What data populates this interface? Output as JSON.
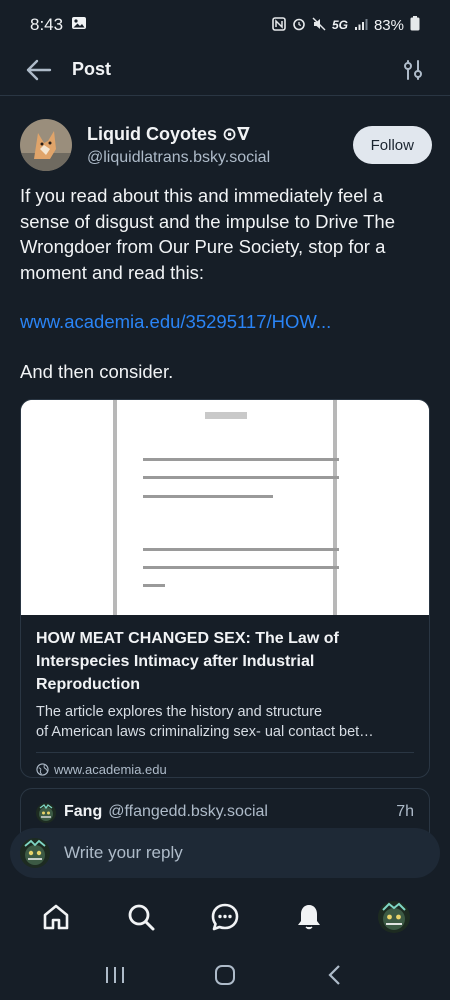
{
  "status_bar": {
    "time": "8:43",
    "network": "5G",
    "battery": "83%"
  },
  "header": {
    "title": "Post"
  },
  "post": {
    "author_display": "Liquid Coyotes ⊙∇",
    "author_handle": "@liquidlatrans.bsky.social",
    "follow_label": "Follow",
    "text_lines": [
      "If you read about this and immediately feel a",
      "sense of disgust and the impulse to Drive The",
      "Wrongdoer from Our Pure Society, stop for a",
      "moment and read this:"
    ],
    "link_text": "www.academia.edu/35295117/HOW...",
    "after_text": "And then consider."
  },
  "embed": {
    "title_lines": [
      "HOW MEAT CHANGED SEX: The Law of",
      "Interspecies Intimacy after Industrial",
      "Reproduction"
    ],
    "desc_line1": "The article explores the history and structure",
    "desc_line2": "of American laws criminalizing sex- ual contact bet…",
    "domain": "www.academia.edu"
  },
  "reply": {
    "name": "Fang",
    "handle": "@ffangedd.bsky.social",
    "time": "7h"
  },
  "compose": {
    "placeholder": "Write your reply"
  },
  "colors": {
    "background": "#161e27",
    "link": "#2a84f5",
    "follow_button": "#e1e7ee"
  }
}
